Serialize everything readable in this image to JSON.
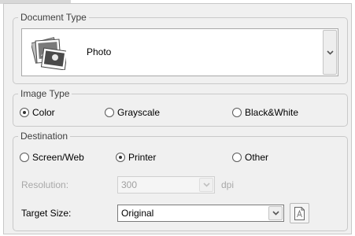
{
  "document_type": {
    "legend": "Document Type",
    "selected": "Photo",
    "icon": "photo-document-icon"
  },
  "image_type": {
    "legend": "Image Type",
    "options": [
      "Color",
      "Grayscale",
      "Black&White"
    ],
    "selected": "Color"
  },
  "destination": {
    "legend": "Destination",
    "options": [
      "Screen/Web",
      "Printer",
      "Other"
    ],
    "selected": "Printer",
    "resolution_label": "Resolution:",
    "resolution_value": "300",
    "resolution_unit": "dpi",
    "resolution_enabled": false,
    "target_size_label": "Target Size:",
    "target_size_value": "Original",
    "target_size_icon": "page-size-icon"
  }
}
